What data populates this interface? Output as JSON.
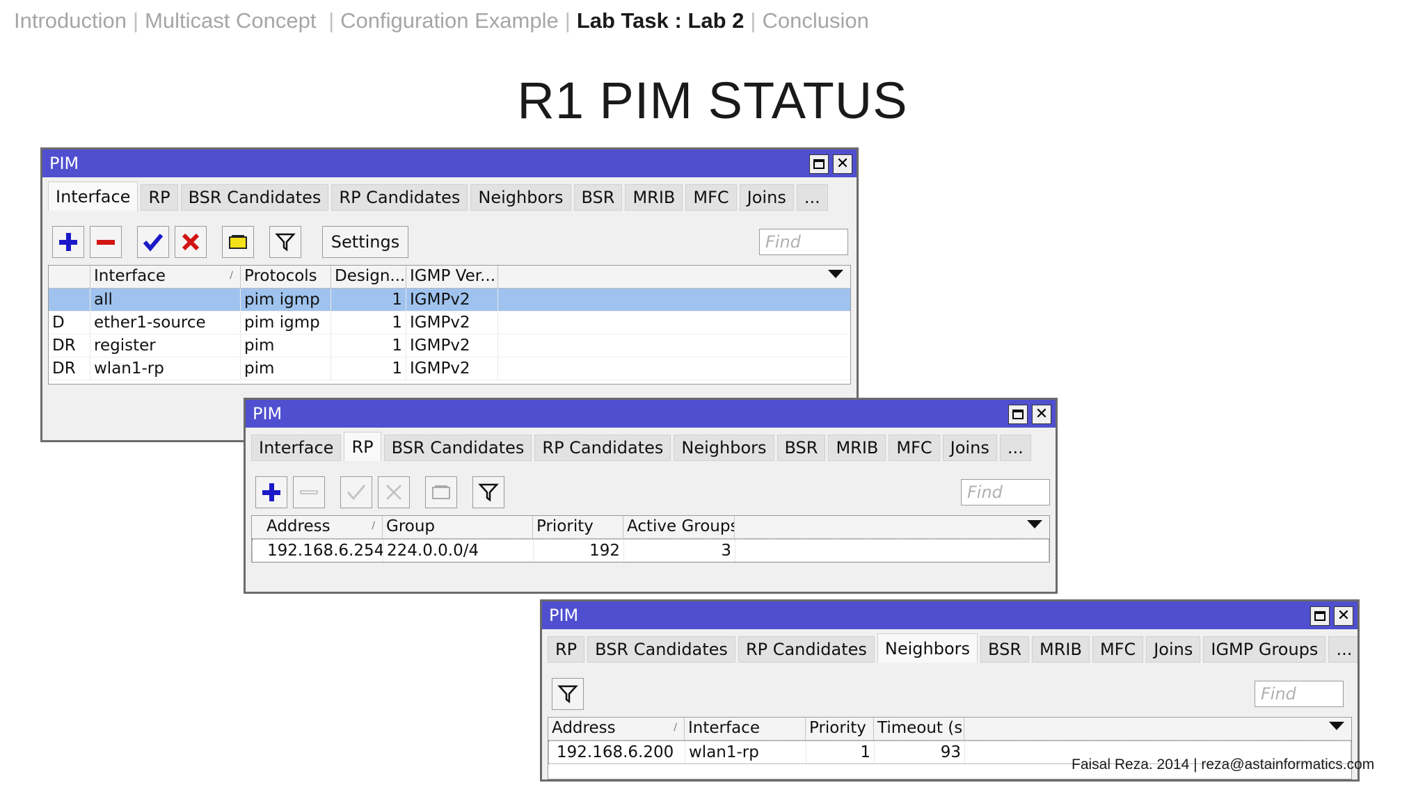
{
  "nav": {
    "items": [
      "Introduction",
      "Multicast Concept",
      "Configuration Example",
      "Lab Task : Lab 2",
      "Conclusion"
    ],
    "active_index": 3
  },
  "slide_title": "R1 PIM STATUS",
  "footer": "Faisal Reza. 2014 | reza@astainformatics.com",
  "windows": {
    "interface": {
      "title": "PIM",
      "tabs": [
        "Interface",
        "RP",
        "BSR Candidates",
        "RP Candidates",
        "Neighbors",
        "BSR",
        "MRIB",
        "MFC",
        "Joins",
        "..."
      ],
      "active_tab": "Interface",
      "settings_label": "Settings",
      "find_placeholder": "Find",
      "columns": [
        "",
        "Interface",
        "Protocols",
        "Design...",
        "IGMP Ver..."
      ],
      "rows": [
        {
          "flags": "",
          "interface": "all",
          "protocols": "pim igmp",
          "designated": "1",
          "igmp": "IGMPv2",
          "selected": true
        },
        {
          "flags": "D",
          "interface": "ether1-source",
          "protocols": "pim igmp",
          "designated": "1",
          "igmp": "IGMPv2"
        },
        {
          "flags": "DR",
          "interface": "register",
          "protocols": "pim",
          "designated": "1",
          "igmp": "IGMPv2"
        },
        {
          "flags": "DR",
          "interface": "wlan1-rp",
          "protocols": "pim",
          "designated": "1",
          "igmp": "IGMPv2"
        }
      ]
    },
    "rp": {
      "title": "PIM",
      "tabs": [
        "Interface",
        "RP",
        "BSR Candidates",
        "RP Candidates",
        "Neighbors",
        "BSR",
        "MRIB",
        "MFC",
        "Joins",
        "..."
      ],
      "active_tab": "RP",
      "find_placeholder": "Find",
      "columns": [
        "Address",
        "Group",
        "Priority",
        "Active Groups"
      ],
      "rows": [
        {
          "address": "192.168.6.254",
          "group": "224.0.0.0/4",
          "priority": "192",
          "active_groups": "3"
        }
      ]
    },
    "neighbors": {
      "title": "PIM",
      "tabs": [
        "RP",
        "BSR Candidates",
        "RP Candidates",
        "Neighbors",
        "BSR",
        "MRIB",
        "MFC",
        "Joins",
        "IGMP Groups",
        "..."
      ],
      "active_tab": "Neighbors",
      "find_placeholder": "Find",
      "columns": [
        "Address",
        "Interface",
        "Priority",
        "Timeout (s)"
      ],
      "rows": [
        {
          "address": "192.168.6.200",
          "interface": "wlan1-rp",
          "priority": "1",
          "timeout": "93"
        }
      ]
    }
  },
  "colors": {
    "titlebar": "#4f4fd0",
    "selected_row": "#9fc3ee",
    "add_icon": "#1a1ac8",
    "remove_icon": "#d21414",
    "enable_icon": "#1a1ac8",
    "disable_icon": "#d21414",
    "comment_icon": "#f5e11a"
  },
  "icons": [
    "plus-icon",
    "minus-icon",
    "check-icon",
    "x-icon",
    "comment-icon",
    "filter-icon",
    "maximize-icon",
    "close-icon",
    "sort-icon",
    "dropdown-arrow-icon"
  ]
}
